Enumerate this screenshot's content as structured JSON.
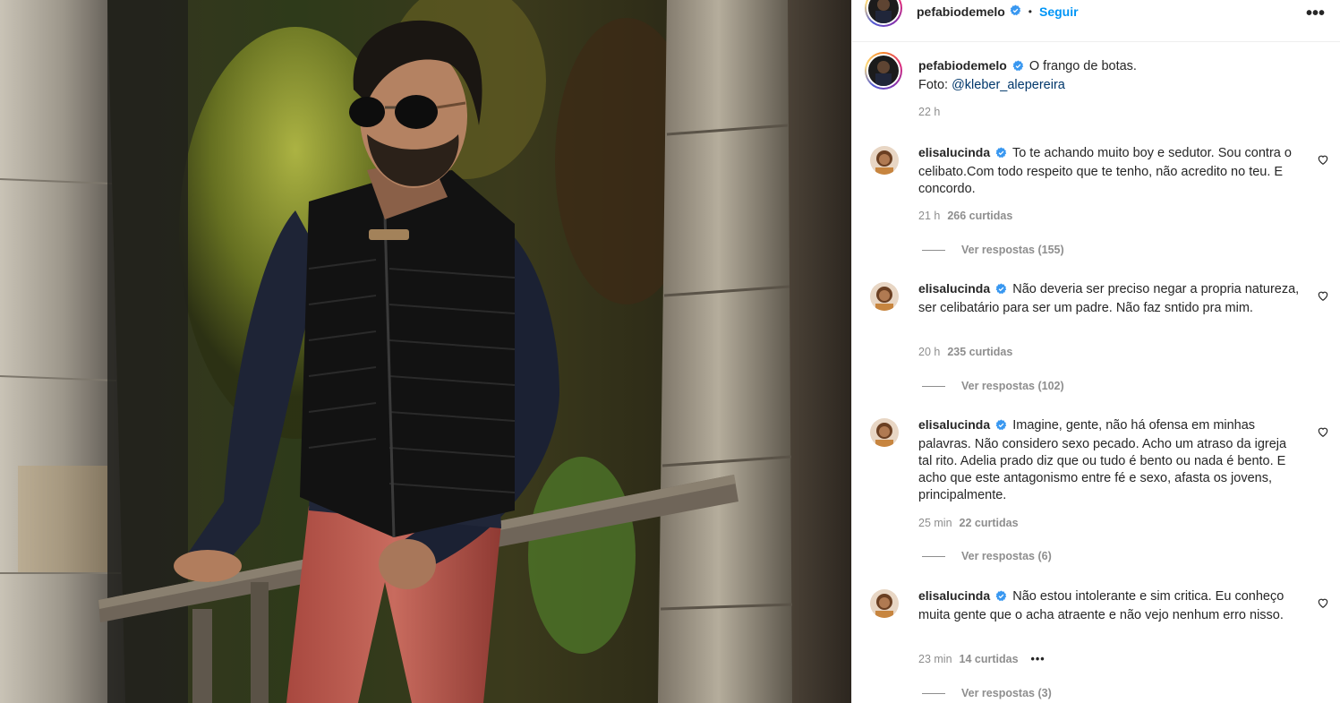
{
  "post": {
    "author": "pefabiodemelo",
    "separator": "•",
    "follow_label": "Seguir",
    "options_icon": "more-options-icon",
    "photo_alt": "Man in sunglasses, black vest and red trousers leaning on a wooden rail beside stone walls"
  },
  "caption": {
    "author": "pefabiodemelo",
    "text": "O frango de botas.",
    "credit_prefix": "Foto: ",
    "credit_link": "@kleber_alepereira",
    "time": "22 h"
  },
  "comments": [
    {
      "author": "elisalucinda",
      "text": "To te achando muito boy e sedutor. Sou contra o celibato.Com todo respeito que te tenho, não acredito no teu. E concordo.",
      "time": "21 h",
      "likes": "266 curtidas",
      "replies": "Ver respostas (155)"
    },
    {
      "author": "elisalucinda",
      "text": "Não deveria ser preciso negar a propria natureza, ser celibatário para ser um padre. Não faz sntido pra mim.",
      "time": "20 h",
      "likes": "235 curtidas",
      "replies": "Ver respostas (102)"
    },
    {
      "author": "elisalucinda",
      "text": "Imagine, gente, não há ofensa em minhas palavras. Não considero sexo pecado. Acho um atraso da igreja tal rito. Adelia prado diz que ou tudo é bento ou nada é bento. E acho que este antagonismo entre fé e sexo, afasta os jovens, principalmente.",
      "time": "25 min",
      "likes": "22 curtidas",
      "replies": "Ver respostas (6)"
    },
    {
      "author": "elisalucinda",
      "text": "Não estou intolerante e sim critica. Eu conheço muita gente que o acha atraente e não vejo nenhum erro nisso.",
      "time": "23 min",
      "likes": "14 curtidas",
      "more": "•••",
      "replies": "Ver respostas (3)"
    }
  ],
  "colors": {
    "verified": "#3897f0",
    "follow": "#0095f6",
    "secondary_text": "#8e8e8e",
    "link": "#00376b"
  }
}
